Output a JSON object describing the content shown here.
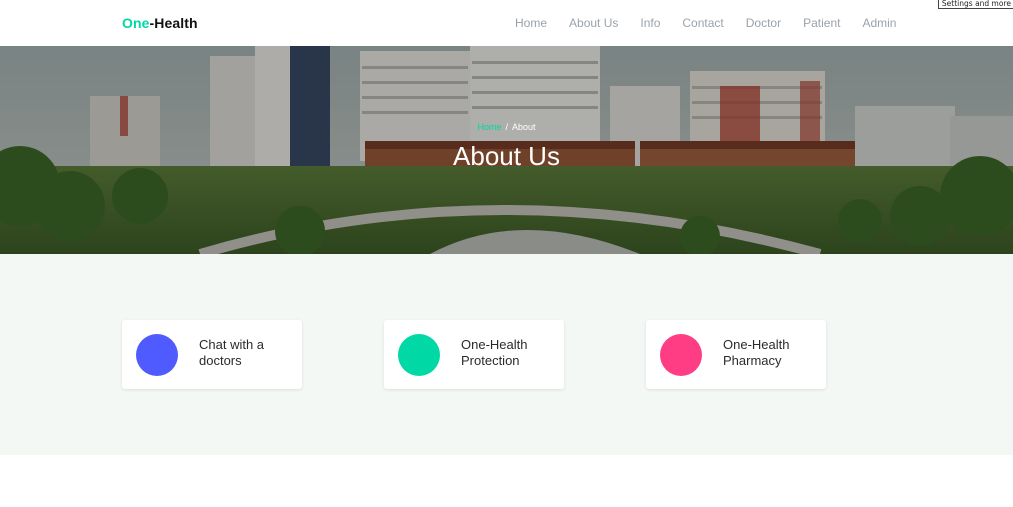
{
  "brand": {
    "accent": "One",
    "rest": "-Health"
  },
  "nav": {
    "items": [
      "Home",
      "About Us",
      "Info",
      "Contact",
      "Doctor",
      "Patient",
      "Admin"
    ]
  },
  "tooltip": "Settings and more",
  "hero": {
    "breadcrumb_home": "Home",
    "breadcrumb_sep": "/",
    "breadcrumb_current": "About",
    "title": "About Us"
  },
  "features": [
    {
      "label": "Chat with a doctors",
      "color": "#4f5bff"
    },
    {
      "label": "One-Health Protection",
      "color": "#00d9a5"
    },
    {
      "label": "One-Health Pharmacy",
      "color": "#ff3d85"
    }
  ],
  "colors": {
    "accent": "#00d9a5",
    "section_bg": "#f3f8f5",
    "nav_text": "#9aa3ab"
  }
}
